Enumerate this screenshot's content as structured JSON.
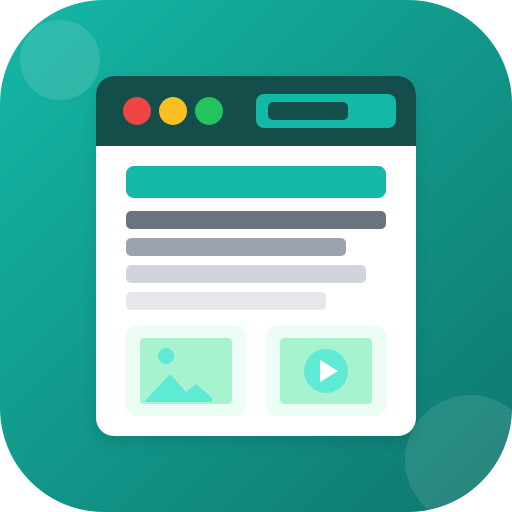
{
  "icon": {
    "name": "browser-webpage-app-icon",
    "colors": {
      "gradient_start": "#14b8a6",
      "gradient_end": "#0f766e",
      "chrome": "#134e4a",
      "accent": "#14b8a6",
      "paper": "#ffffff",
      "card": "#ecfdf5",
      "thumb": "#a7f3d0",
      "mint": "#5eead4"
    }
  },
  "window_controls": {
    "close": {
      "icon": "close-dot-icon",
      "color": "#ef4444"
    },
    "minimize": {
      "icon": "minimize-dot-icon",
      "color": "#fbbf24"
    },
    "maximize": {
      "icon": "maximize-dot-icon",
      "color": "#22c55e"
    }
  },
  "media_cards": [
    {
      "icon": "image-icon"
    },
    {
      "icon": "play-icon"
    }
  ]
}
